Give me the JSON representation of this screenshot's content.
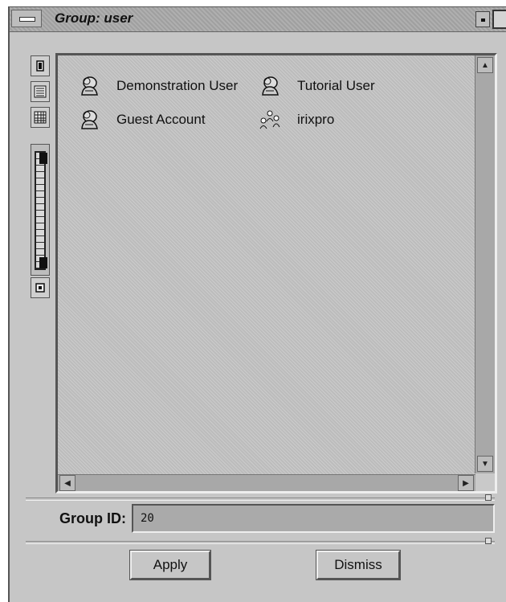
{
  "window": {
    "title": "Group: user"
  },
  "icons": [
    {
      "label": "Demonstration User",
      "icon": "user-icon"
    },
    {
      "label": "Tutorial User",
      "icon": "user-icon"
    },
    {
      "label": "Guest Account",
      "icon": "user-icon"
    },
    {
      "label": "irixpro",
      "icon": "group-people-icon"
    }
  ],
  "group_id": {
    "label": "Group ID:",
    "value": "20"
  },
  "buttons": {
    "apply": "Apply",
    "dismiss": "Dismiss"
  }
}
